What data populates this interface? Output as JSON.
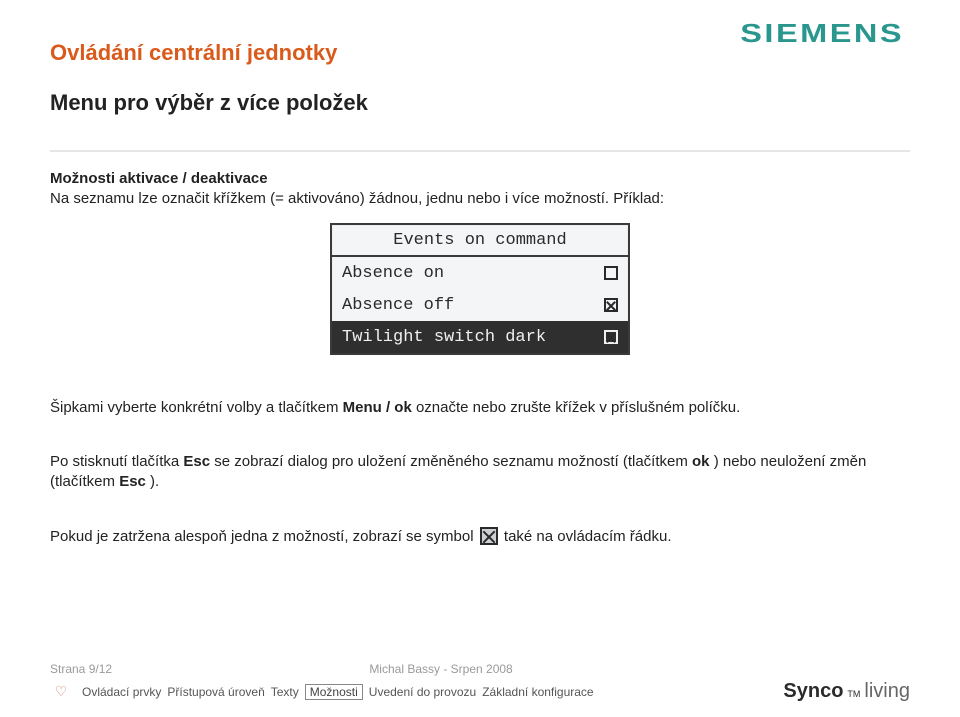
{
  "brand": "SIEMENS",
  "header": {
    "title1": "Ovládání centrální jednotky",
    "title2": "Menu pro výběr z více položek"
  },
  "body": {
    "subhead": "Možnosti aktivace / deaktivace",
    "intro": "Na seznamu lze označit křížkem (= aktivováno) žádnou, jednu nebo i více možností. Příklad:",
    "para2_before": "Šipkami vyberte konkrétní volby a tlačítkem ",
    "para2_bold1": "Menu / ok",
    "para2_after": " označte nebo zrušte křížek v příslušném políčku.",
    "para3_a": "Po stisknutí tlačítka ",
    "para3_b": "Esc",
    "para3_c": " se zobrazí dialog pro uložení změněného seznamu možností (tlačítkem ",
    "para3_d": "ok",
    "para3_e": " ) nebo neuložení změn (tlačítkem ",
    "para3_f": "Esc",
    "para3_g": " ).",
    "para4_a": "Pokud je zatržena alespoň jedna z možností, zobrazí se symbol ",
    "para4_b": " také na ovládacím řádku."
  },
  "lcd": {
    "title": "Events on command",
    "rows": [
      {
        "label": "Absence on",
        "checked": false,
        "selected": false
      },
      {
        "label": "Absence off",
        "checked": true,
        "selected": false
      },
      {
        "label": "Twilight switch dark",
        "checked": true,
        "selected": true
      }
    ]
  },
  "footer": {
    "page": "Strana 9/12",
    "author": "Michal Bassy - Srpen 2008",
    "nav": [
      "Ovládací prvky",
      "Přístupová úroveň",
      "Texty",
      "Možnosti",
      "Uvedení do provozu",
      "Základní konfigurace"
    ],
    "boxed_index": 3,
    "product": {
      "bold": "Synco",
      "tm": "TM",
      "light": "living"
    }
  }
}
